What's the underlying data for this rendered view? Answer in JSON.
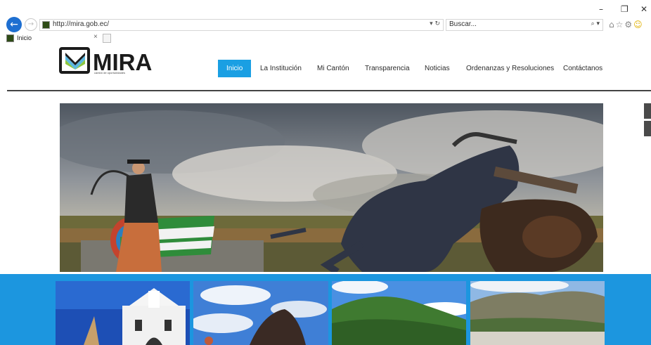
{
  "browser": {
    "url": "http://mira.gob.ec/",
    "address_controls": "▾ ↻",
    "search_placeholder": "Buscar...",
    "search_controls": "⌕ ▾",
    "tab_title": "Inicio",
    "tab_close": "×",
    "minimize": "–",
    "restore": "❐",
    "close": "✕"
  },
  "site": {
    "logo_text": "MIRA",
    "logo_tagline": "cantón de oportunidades",
    "nav": [
      {
        "label": "Inicio",
        "active": true
      },
      {
        "label": "La Institución",
        "active": false
      },
      {
        "label": "Mi Cantón",
        "active": false
      },
      {
        "label": "Transparencia",
        "active": false
      },
      {
        "label": "Noticias",
        "active": false
      },
      {
        "label": "Ordenanzas y Resoluciones",
        "active": false
      },
      {
        "label": "Contáctanos",
        "active": false
      }
    ]
  },
  "colors": {
    "accent": "#1a9fe3",
    "band": "#1c96df",
    "browser_back": "#1e6fd1"
  },
  "icons": [
    "back-arrow-icon",
    "forward-arrow-icon",
    "refresh-icon",
    "search-icon",
    "home-icon",
    "star-icon",
    "settings-icon",
    "smiley-icon"
  ]
}
